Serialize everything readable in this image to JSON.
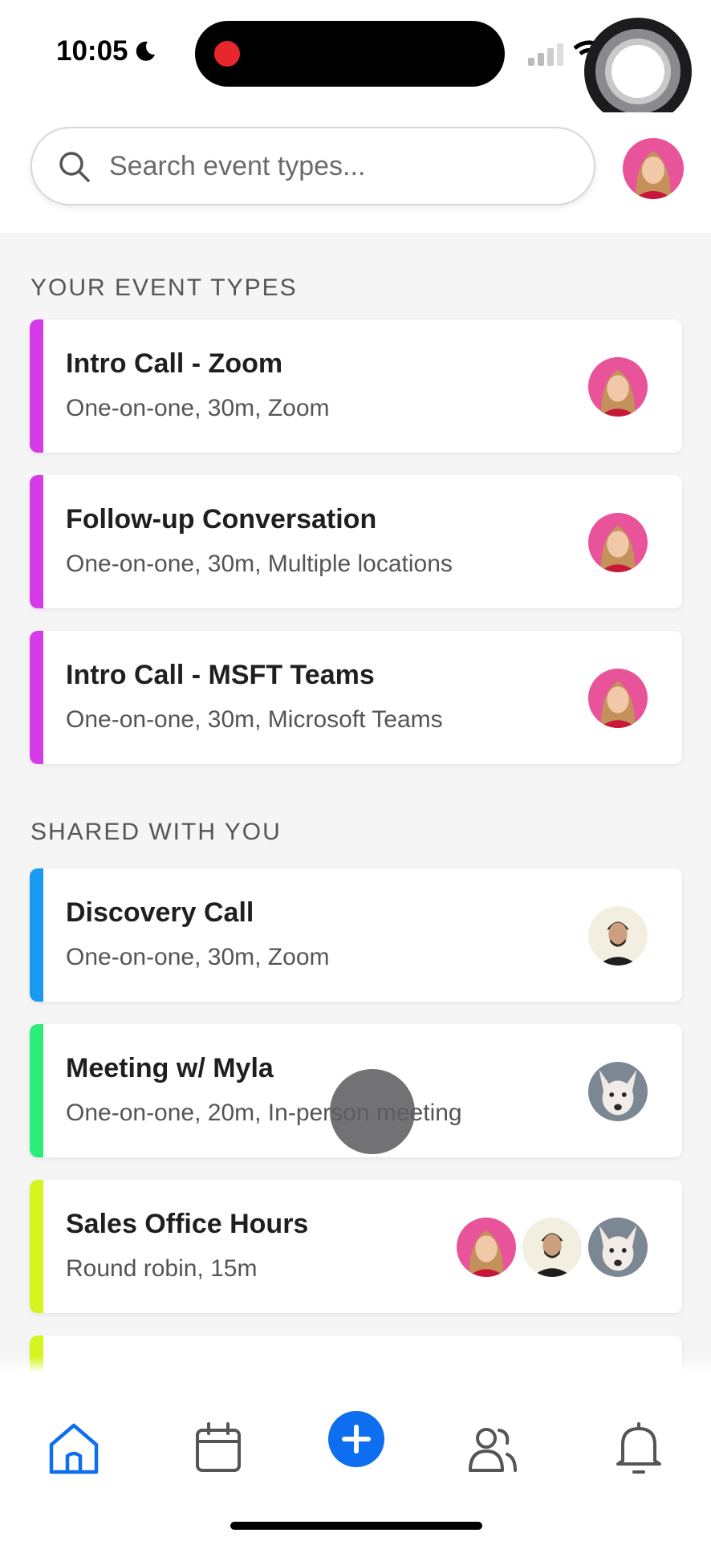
{
  "status_bar": {
    "time": "10:05"
  },
  "search": {
    "placeholder": "Search event types..."
  },
  "colors": {
    "magenta": "#d63be8",
    "blue": "#1a9af0",
    "green": "#2ded7a",
    "lime": "#d4f51d",
    "accent": "#0d6ef0"
  },
  "sections": {
    "your_event_types": "YOUR EVENT TYPES",
    "shared_with_you": "SHARED WITH YOU"
  },
  "your_events": [
    {
      "title": "Intro Call - Zoom",
      "subtitle": "One-on-one, 30m, Zoom"
    },
    {
      "title": "Follow-up Conversation",
      "subtitle": "One-on-one, 30m, Multiple locations"
    },
    {
      "title": "Intro Call - MSFT Teams",
      "subtitle": "One-on-one, 30m, Microsoft Teams"
    }
  ],
  "shared_events": [
    {
      "title": "Discovery Call",
      "subtitle": "One-on-one, 30m, Zoom"
    },
    {
      "title": "Meeting w/ Myla",
      "subtitle": "One-on-one, 20m, In-person meeting"
    },
    {
      "title": "Sales Office Hours",
      "subtitle": "Round robin, 15m"
    }
  ],
  "tab_bar": {
    "items": [
      "home-icon",
      "calendar-icon",
      "add-icon",
      "people-icon",
      "bell-icon"
    ],
    "active": "home-icon"
  }
}
